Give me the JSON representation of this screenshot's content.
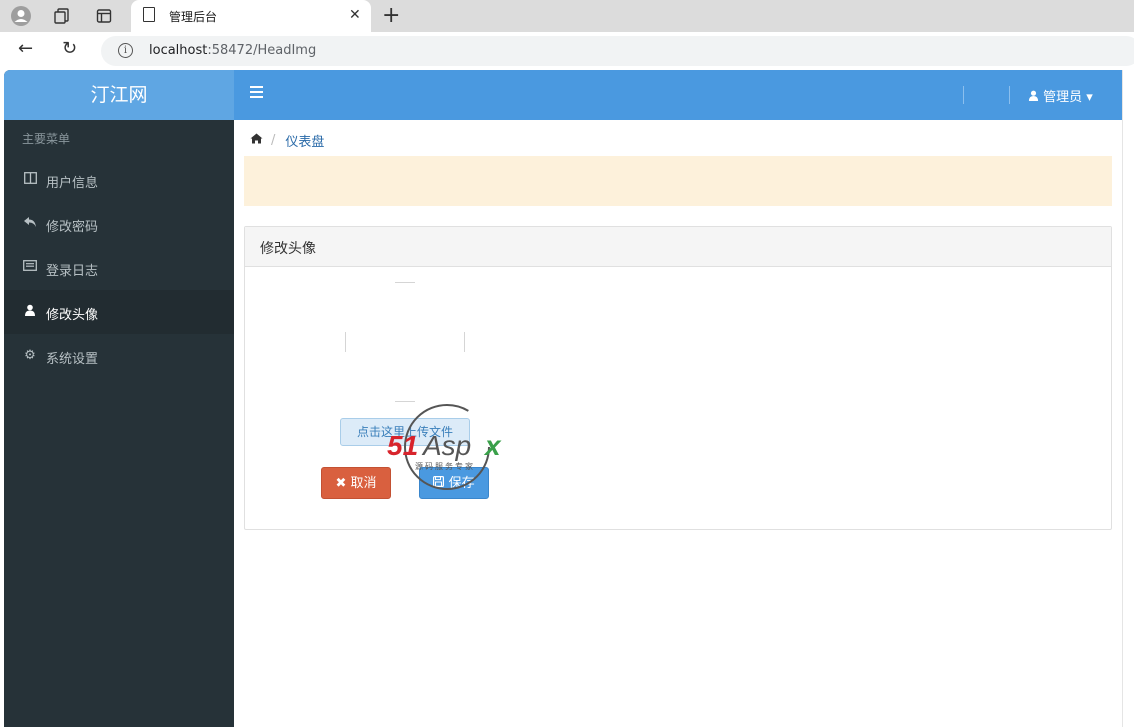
{
  "browser": {
    "tab_title": "管理后台",
    "tab_close": "✕",
    "new_tab": "+",
    "url_host": "localhost",
    "url_rest": ":58472/HeadImg",
    "info_glyph": "i",
    "back_glyph": "←",
    "reload_glyph": "↻"
  },
  "sidebar": {
    "brand": "汀江网",
    "heading": "主要菜单",
    "items": [
      {
        "label": "用户信息",
        "icon": "columns-icon",
        "glyph": "◫"
      },
      {
        "label": "修改密码",
        "icon": "reply-icon",
        "glyph": "↶"
      },
      {
        "label": "登录日志",
        "icon": "list-icon",
        "glyph": "▤"
      },
      {
        "label": "修改头像",
        "icon": "user-icon",
        "glyph": "●",
        "active": true
      },
      {
        "label": "系统设置",
        "icon": "cogs-icon",
        "glyph": "⚙"
      }
    ]
  },
  "topbar": {
    "user_label": "管理员",
    "user_glyph": "👤",
    "caret": "▾"
  },
  "breadcrumb": {
    "home_glyph": "⌂",
    "separator": "/",
    "current": "仪表盘"
  },
  "panel": {
    "title": "修改头像",
    "upload_label": "点击这里上传文件",
    "cancel_label": "取消",
    "cancel_glyph": "✖",
    "save_label": "保存",
    "save_glyph": "🖫"
  },
  "watermark": {
    "brand": "51Aspx",
    "tagline": "源码服务专家"
  },
  "colors": {
    "sidebar": "#263238",
    "brand": "#5fa6e3",
    "topbar": "#4a99e0",
    "alert": "#fdf1db",
    "cancel": "#d9603f",
    "save": "#4a99e0"
  }
}
